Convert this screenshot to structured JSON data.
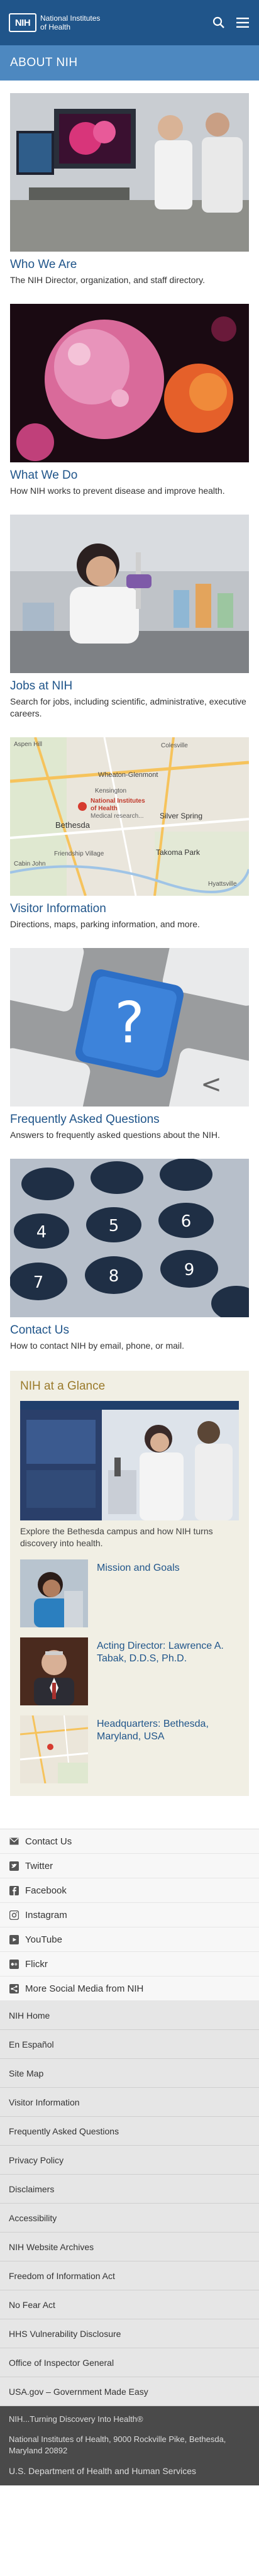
{
  "header": {
    "logo_mark": "NIH",
    "logo_line1": "National Institutes",
    "logo_line2": "of Health",
    "search_icon": "search-icon",
    "menu_icon": "hamburger-menu-icon"
  },
  "subbar": {
    "title": "ABOUT NIH"
  },
  "cards": [
    {
      "title": "Who We Are",
      "desc": "The NIH Director, organization, and staff directory."
    },
    {
      "title": "What We Do",
      "desc": "How NIH works to prevent disease and improve health."
    },
    {
      "title": "Jobs at NIH",
      "desc": "Search for jobs, including scientific, administrative, executive careers."
    },
    {
      "title": "Visitor Information",
      "desc": "Directions, maps, parking information, and more."
    },
    {
      "title": "Frequently Asked Questions",
      "desc": "Answers to frequently asked questions about the NIH."
    },
    {
      "title": "Contact Us",
      "desc": "How to contact NIH by email, phone, or mail."
    }
  ],
  "map": {
    "pin_label1": "National Institutes",
    "pin_label2": "of Health",
    "pin_label3": "Medical research...",
    "place1": "Aspen Hill",
    "place2": "Colesville",
    "place3": "Wheaton-Glenmont",
    "place4": "Bethesda",
    "place5": "Kensington",
    "place6": "Silver Spring",
    "place7": "Takoma Park",
    "place8": "Cabin John",
    "place9": "Friendship Village",
    "place10": "Hyattsville"
  },
  "glance": {
    "title": "NIH at a Glance",
    "hero_desc": "Explore the Bethesda campus and how NIH turns discovery into health.",
    "items": [
      {
        "label": "Mission and Goals"
      },
      {
        "label": "Acting Director: Lawrence A. Tabak, D.D.S, Ph.D."
      },
      {
        "label": "Headquarters: Bethesda, Maryland, USA"
      }
    ]
  },
  "social": [
    {
      "icon": "envelope-icon",
      "label": "Contact Us"
    },
    {
      "icon": "twitter-icon",
      "label": "Twitter"
    },
    {
      "icon": "facebook-icon",
      "label": "Facebook"
    },
    {
      "icon": "instagram-icon",
      "label": "Instagram"
    },
    {
      "icon": "youtube-icon",
      "label": "YouTube"
    },
    {
      "icon": "flickr-icon",
      "label": "Flickr"
    },
    {
      "icon": "share-icon",
      "label": "More Social Media from NIH"
    }
  ],
  "footer_links": [
    "NIH Home",
    "En Español",
    "Site Map",
    "Visitor Information",
    "Frequently Asked Questions",
    "Privacy Policy",
    "Disclaimers",
    "Accessibility",
    "NIH Website Archives",
    "Freedom of Information Act",
    "No Fear Act",
    "HHS Vulnerability Disclosure",
    "Office of Inspector General",
    "USA.gov – Government Made Easy"
  ],
  "bottom": {
    "tagline": "NIH...Turning Discovery Into Health®",
    "address": "National Institutes of Health, 9000 Rockville Pike, Bethesda, Maryland 20892",
    "hhs": "U.S. Department of Health and Human Services"
  },
  "colors": {
    "header_bg": "#20558a",
    "subbar_bg": "#4d88c0",
    "link": "#20558a",
    "glance_bg": "#f1efe4"
  }
}
